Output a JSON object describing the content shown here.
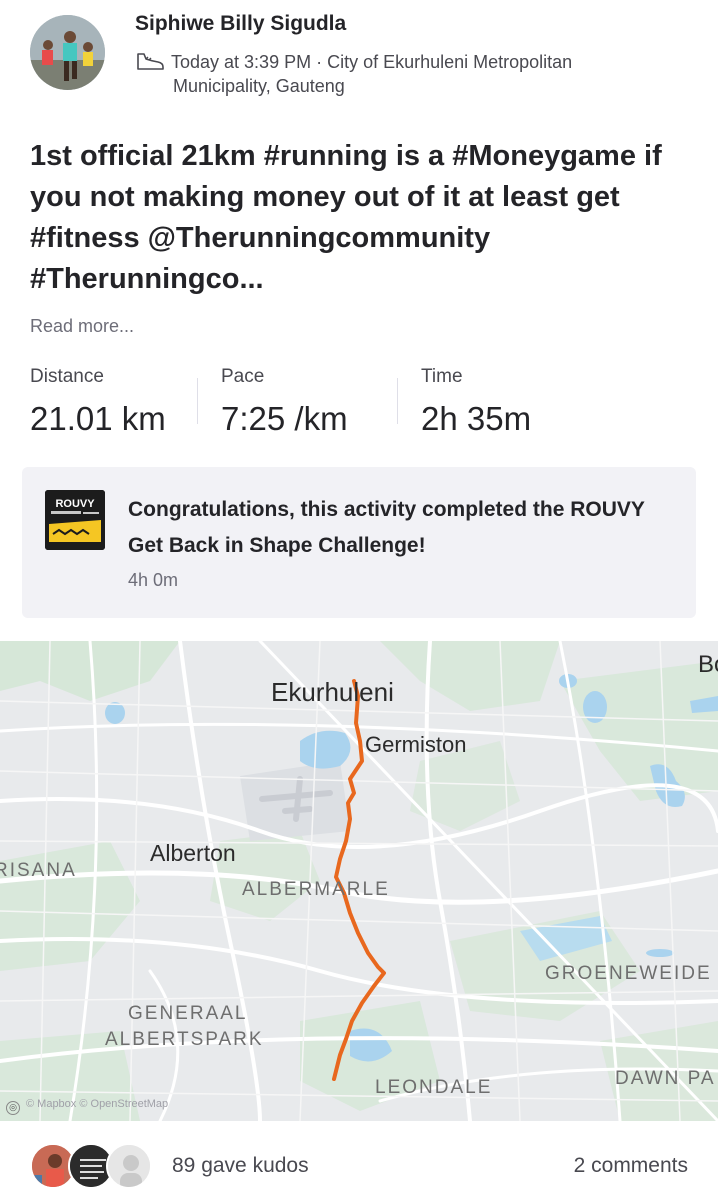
{
  "header": {
    "athlete_name": "Siphiwe Billy Sigudla",
    "meta_line1": "Today at 3:39 PM · City of Ekurhuleni Metropolitan",
    "meta_line2": "Municipality, Gauteng",
    "activity_icon": "shoe-icon"
  },
  "post": {
    "title": "1st official 21km #running is a #Moneygame if you not making money out of it at least get #fitness @Therunningcommunity #Therunningco...",
    "read_more": "Read more..."
  },
  "stats": [
    {
      "label": "Distance",
      "value": "21.01 km"
    },
    {
      "label": "Pace",
      "value": "7:25 /km"
    },
    {
      "label": "Time",
      "value": "2h 35m"
    }
  ],
  "challenge": {
    "badge_text": "ROUVY",
    "message": "Congratulations, this activity completed the ROUVY Get Back in Shape Challenge!",
    "duration": "4h 0m"
  },
  "map": {
    "labels": {
      "ekurhuleni": "Ekurhuleni",
      "germiston": "Germiston",
      "alberton": "Alberton",
      "albermarle": "ALBERMARLE",
      "risana": "RISANA",
      "groeneweide": "GROENEWEIDE",
      "generaal1": "GENERAAL",
      "generaal2": "ALBERTSPARK",
      "leondale": "LEONDALE",
      "dawnpark": "DAWN PA",
      "bo": "Bo"
    },
    "attribution": "© Mapbox © OpenStreetMap",
    "route_color": "#e8681e",
    "water_color": "#aad3ee",
    "park_color": "#cfe6d0"
  },
  "footer": {
    "kudos": "89 gave kudos",
    "comments": "2 comments"
  }
}
